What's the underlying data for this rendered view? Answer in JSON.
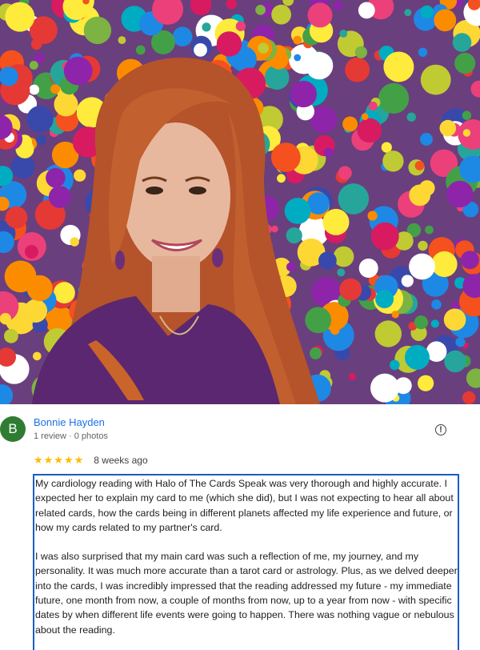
{
  "reviewer": {
    "initial": "B",
    "name": "Bonnie Hayden",
    "meta": "1 review · 0 photos",
    "avatar_color": "#2e7d32"
  },
  "review": {
    "stars": "★★★★★",
    "rating": 5,
    "time": "8 weeks ago",
    "paragraphs": [
      "My cardiology reading with Halo of The Cards Speak was very thorough and highly accurate. I expected her to explain my card to me (which she did), but I was not expecting to hear all about related cards, how the cards being in different planets affected my life experience and future, or how my cards related to my partner's card.",
      "I was also surprised that my main card was such a reflection of me, my journey, and my personality. It was much more accurate than a tarot card or astrology. Plus, as we delved deeper into the cards, I was incredibly impressed that the reading addressed my future - my immediate future, one month from now, a couple of months from now, up to a year from now - with specific dates by when different life events were going to happen. There was nothing vague or nebulous about the reading."
    ]
  },
  "icons": {
    "report": "report-flag-icon"
  },
  "colors": {
    "link": "#1a73e8",
    "star": "#fbbc04",
    "focus_border": "#1a5cc7"
  }
}
